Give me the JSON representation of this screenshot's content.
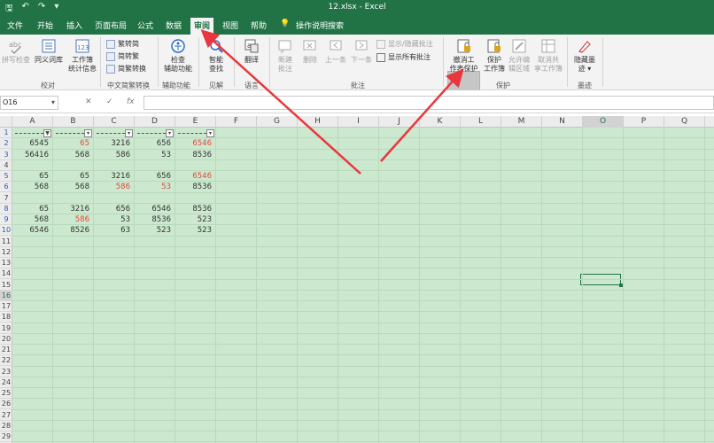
{
  "window": {
    "title": "12.xlsx - Excel"
  },
  "tabs": [
    "文件",
    "开始",
    "插入",
    "页面布局",
    "公式",
    "数据",
    "审阅",
    "视图",
    "帮助"
  ],
  "active_tab": "审阅",
  "tell_me": "操作说明搜索",
  "ribbon": {
    "proofing": {
      "spell": "拼写检查",
      "thesaurus": "同义词库",
      "stats1": "工作簿",
      "stats2": "统计信息",
      "label": "校对"
    },
    "chinese": {
      "t2s": "繁转简",
      "s2t": "简转繁",
      "convert": "简繁转换",
      "label": "中文简繁转换"
    },
    "accessibility": {
      "check1": "检查",
      "check2": "辅助功能",
      "label": "辅助功能"
    },
    "insights": {
      "smart1": "智能",
      "smart2": "查找",
      "label": "见解"
    },
    "language": {
      "translate": "翻译",
      "label": "语言"
    },
    "comments": {
      "new1": "新建",
      "new2": "批注",
      "delete": "删除",
      "prev": "上一条",
      "next": "下一条",
      "show_hide": "显示/隐藏批注",
      "show_all": "显示所有批注",
      "label": "批注"
    },
    "protect": {
      "unprotect1": "撤消工",
      "unprotect2": "作表保护",
      "protect_wb1": "保护",
      "protect_wb2": "工作簿",
      "allow1": "允许编",
      "allow2": "辑区域",
      "unshare1": "取消共",
      "unshare2": "享工作簿",
      "label": "保护"
    },
    "ink": {
      "hide1": "隐藏墨",
      "hide2": "迹 ▾",
      "label": "墨迹"
    }
  },
  "formula_bar": {
    "name_box": "O16",
    "cancel": "✕",
    "enter": "✓",
    "fx": "fx",
    "value": ""
  },
  "columns": [
    "A",
    "B",
    "C",
    "D",
    "E",
    "F",
    "G",
    "H",
    "I",
    "J",
    "K",
    "L",
    "M",
    "N",
    "O",
    "P",
    "Q"
  ],
  "selected_column": "O",
  "rows": [
    "1",
    "2",
    "3",
    "4",
    "5",
    "6",
    "7",
    "8",
    "9",
    "10",
    "11",
    "12",
    "13",
    "14",
    "15",
    "16",
    "17",
    "18",
    "19",
    "20",
    "21",
    "22",
    "23",
    "24",
    "25",
    "26",
    "27",
    "28",
    "29"
  ],
  "selected_row": "16",
  "filtered_rows": [
    "1",
    "2",
    "3",
    "5",
    "6",
    "8",
    "9",
    "10"
  ],
  "filter_icons": [
    "▼",
    "▾",
    "▾",
    "▾",
    "▾"
  ],
  "data": [
    [
      {
        "v": "6545"
      },
      {
        "v": "65",
        "red": true
      },
      {
        "v": "3216"
      },
      {
        "v": "656"
      },
      {
        "v": "6546",
        "red": true
      }
    ],
    [
      {
        "v": "56416"
      },
      {
        "v": "568"
      },
      {
        "v": "586"
      },
      {
        "v": "53"
      },
      {
        "v": "8536"
      }
    ],
    [
      {
        "v": "65"
      },
      {
        "v": "65"
      },
      {
        "v": "3216"
      },
      {
        "v": "656"
      },
      {
        "v": "6546",
        "red": true
      }
    ],
    [
      {
        "v": "568"
      },
      {
        "v": "568"
      },
      {
        "v": "586",
        "red": true
      },
      {
        "v": "53",
        "red": true
      },
      {
        "v": "8536"
      }
    ],
    [
      {
        "v": "65"
      },
      {
        "v": "3216"
      },
      {
        "v": "656"
      },
      {
        "v": "6546"
      },
      {
        "v": "8536"
      }
    ],
    [
      {
        "v": "568"
      },
      {
        "v": "586",
        "red": true
      },
      {
        "v": "53"
      },
      {
        "v": "8536"
      },
      {
        "v": "523"
      }
    ],
    [
      {
        "v": "6546"
      },
      {
        "v": "8526"
      },
      {
        "v": "63"
      },
      {
        "v": "523"
      },
      {
        "v": "523"
      }
    ]
  ],
  "colors": {
    "excel_green": "#217346",
    "grid_bg": "#cce8cf",
    "red_text": "#e04a3a",
    "arrow_red": "#e8383d"
  },
  "icons": [
    "save-icon",
    "undo-icon",
    "redo-icon",
    "lightbulb-icon",
    "spellcheck-icon",
    "thesaurus-icon",
    "stats-icon",
    "accessibility-icon",
    "smart-lookup-icon",
    "translate-icon",
    "comment-icon",
    "unprotect-sheet-icon",
    "protect-workbook-icon",
    "hide-ink-icon"
  ]
}
